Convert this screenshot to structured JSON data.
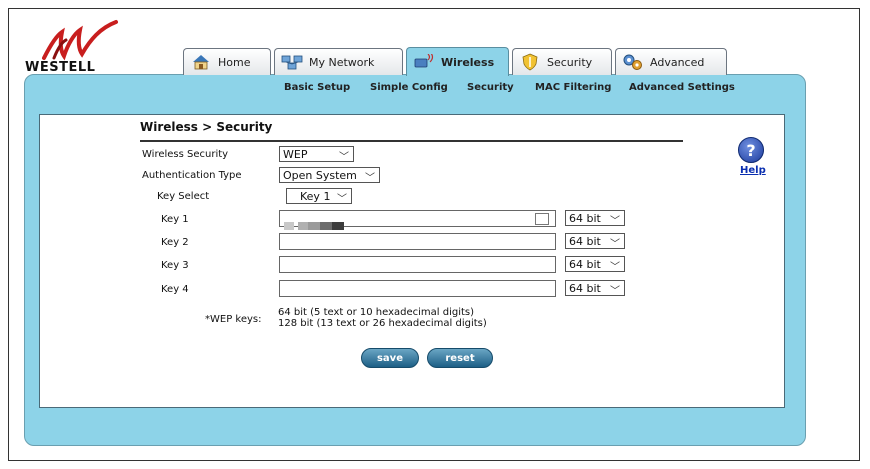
{
  "brand": {
    "name": "WESTELL"
  },
  "tabs": [
    {
      "label": "Home",
      "icon": "house-icon"
    },
    {
      "label": "My Network",
      "icon": "network-icon"
    },
    {
      "label": "Wireless",
      "icon": "wireless-icon"
    },
    {
      "label": "Security",
      "icon": "shield-icon"
    },
    {
      "label": "Advanced",
      "icon": "gears-icon"
    }
  ],
  "subnav": [
    "Basic Setup",
    "Simple Config",
    "Security",
    "MAC Filtering",
    "Advanced Settings"
  ],
  "page": {
    "title": "Wireless > Security",
    "help_label": "Help"
  },
  "form": {
    "wireless_security": {
      "label": "Wireless Security",
      "value": "WEP"
    },
    "auth_type": {
      "label": "Authentication Type",
      "value": "Open System"
    },
    "key_select": {
      "label": "Key Select",
      "value": "Key 1"
    },
    "keys": [
      {
        "label": "Key 1",
        "bits": "64 bit"
      },
      {
        "label": "Key 2",
        "bits": "64 bit"
      },
      {
        "label": "Key 3",
        "bits": "64 bit"
      },
      {
        "label": "Key 4",
        "bits": "64 bit"
      }
    ],
    "wep_note_label": "*WEP keys:",
    "wep_note_line1": "64 bit (5 text or 10 hexadecimal digits)",
    "wep_note_line2": "128 bit (13 text or 26 hexadecimal digits)"
  },
  "buttons": {
    "save": "save",
    "reset": "reset"
  }
}
